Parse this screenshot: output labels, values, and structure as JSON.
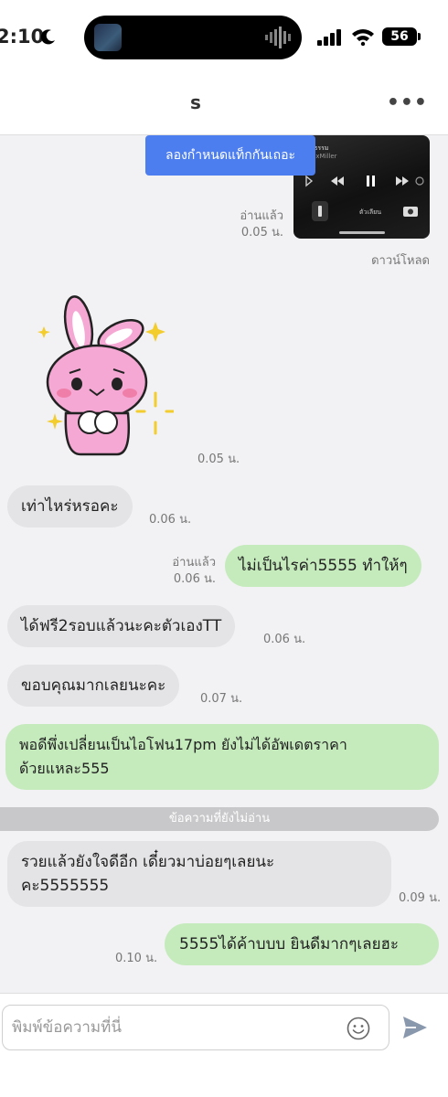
{
  "status_bar": {
    "time": "2:10",
    "battery": "56"
  },
  "header": {
    "title": "s",
    "more": "•••"
  },
  "tag_tip": "ลองกำหนดแท็กกันเถอะ",
  "media_preview": {
    "song": "ไม่ธรรม",
    "artist": "MaxMiller",
    "flashlight_label": "ตัวเลียน",
    "read_label": "อ่านแล้ว",
    "time": "0.05 น.",
    "download": "ดาวน์โหลด"
  },
  "sticker": {
    "icon": "pink-bunny-sticker",
    "time": "0.05 น."
  },
  "messages": [
    {
      "dir": "in",
      "text": "เท่าไหร่หรอคะ",
      "time": "0.06 น."
    },
    {
      "dir": "out",
      "text": "ไม่เป็นไรค่า5555 ทำให้ๆ",
      "read": "อ่านแล้ว",
      "time": "0.06 น."
    },
    {
      "dir": "in",
      "text": "ได้ฟรี2รอบแล้วนะคะตัวเองTT",
      "time": "0.06 น."
    },
    {
      "dir": "in",
      "text": "ขอบคุณมากเลยนะคะ",
      "time": "0.07 น."
    },
    {
      "dir": "out",
      "line1": "พอดีพึ่งเปลี่ยนเป็นไอโฟน17pm ยังไม่ได้อัพเดตราคา",
      "line2": "ด้วยแหละ555"
    },
    {
      "dir": "in",
      "line1": "รวยแล้วยังใจดีอีก เดี๋ยวมาบ่อยๆเลยนะ",
      "line2": "คะ5555555",
      "time": "0.09 น."
    },
    {
      "dir": "out",
      "text": "5555ได้ค้าบบบ ยินดีมากๆเลยฮะ",
      "time": "0.10 น."
    }
  ],
  "unread_divider": "ข้อความที่ยังไม่อ่าน",
  "input": {
    "placeholder": "พิมพ์ข้อความที่นี่"
  },
  "colors": {
    "incoming_bubble": "#e4e4e6",
    "outgoing_bubble": "#c5ebbd",
    "tag_tip": "#4d7ef0",
    "send_icon": "#8a98ad"
  }
}
